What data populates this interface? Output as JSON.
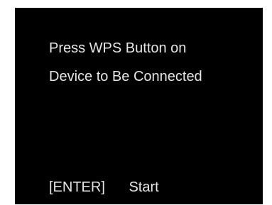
{
  "screen": {
    "background": "#000000",
    "text_color": "#e6e6e6",
    "message_lines": [
      "Press WPS Button on",
      "Device to Be Connected"
    ],
    "footer": {
      "key": "[ENTER]",
      "action": "Start"
    }
  }
}
